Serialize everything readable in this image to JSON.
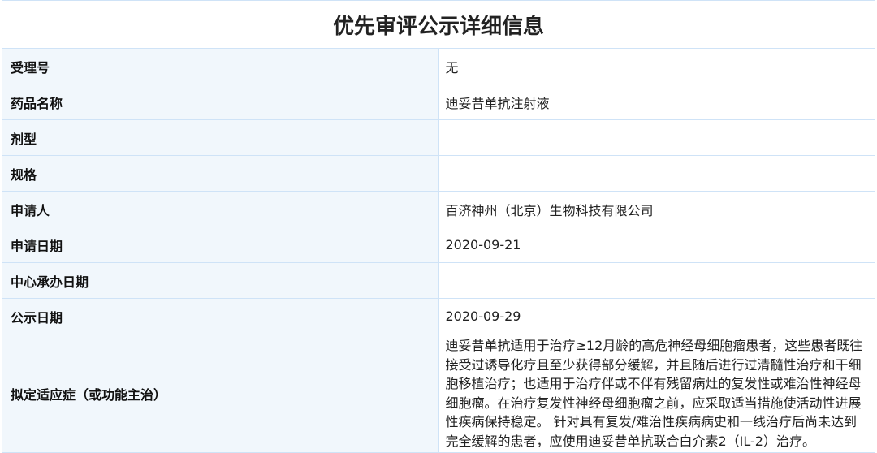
{
  "title": "优先审评公示详细信息",
  "rows": [
    {
      "label": "受理号",
      "value": "无"
    },
    {
      "label": "药品名称",
      "value": "迪妥昔单抗注射液"
    },
    {
      "label": "剂型",
      "value": ""
    },
    {
      "label": "规格",
      "value": ""
    },
    {
      "label": "申请人",
      "value": "百济神州（北京）生物科技有限公司"
    },
    {
      "label": "申请日期",
      "value": "2020-09-21"
    },
    {
      "label": "中心承办日期",
      "value": ""
    },
    {
      "label": "公示日期",
      "value": "2020-09-29"
    },
    {
      "label": "拟定适应症（或功能主治）",
      "value": "迪妥昔单抗适用于治疗≥12月龄的高危神经母细胞瘤患者，这些患者既往接受过诱导化疗且至少获得部分缓解，并且随后进行过清髓性治疗和干细胞移植治疗；也适用于治疗伴或不伴有残留病灶的复发性或难治性神经母细胞瘤。在治疗复发性神经母细胞瘤之前，应采取适当措施使活动性进展性疾病保持稳定。 针对具有复发/难治性疾病病史和一线治疗后尚未达到完全缓解的患者，应使用迪妥昔单抗联合白介素2（IL-2）治疗。"
    }
  ]
}
